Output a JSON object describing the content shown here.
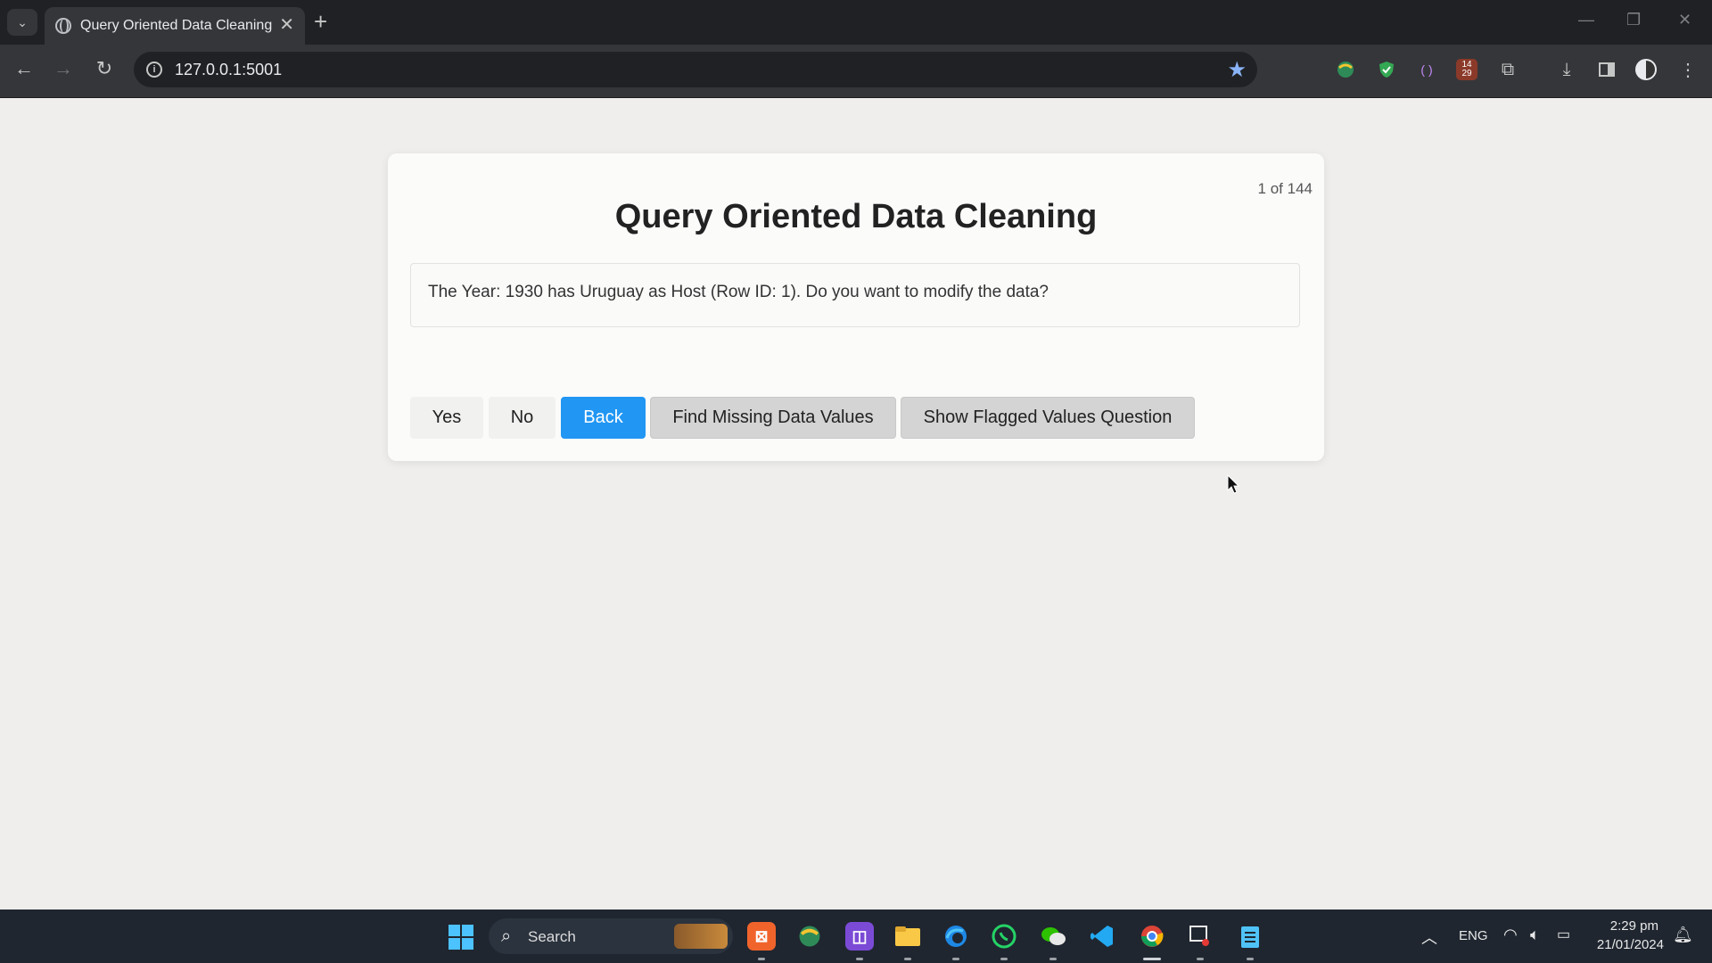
{
  "browser": {
    "tab_title": "Query Oriented Data Cleaning",
    "new_tab_symbol": "+",
    "url": "127.0.0.1:5001"
  },
  "page": {
    "counter": "1 of 144",
    "title": "Query Oriented Data Cleaning",
    "question": "The Year: 1930 has Uruguay as Host (Row ID: 1). Do you want to modify the data?",
    "buttons": {
      "yes": "Yes",
      "no": "No",
      "back": "Back",
      "find_missing": "Find Missing Data Values",
      "show_flagged": "Show Flagged Values Question"
    }
  },
  "taskbar": {
    "search_label": "Search",
    "language": "ENG",
    "time": "2:29 pm",
    "date": "21/01/2024"
  },
  "colors": {
    "primary_button": "#2196f3",
    "page_background": "#efeeec",
    "card_background": "#fbfbfa",
    "taskbar": "#1f2630",
    "chrome_dark": "#202124"
  },
  "extension_calendar_text": "14 29"
}
